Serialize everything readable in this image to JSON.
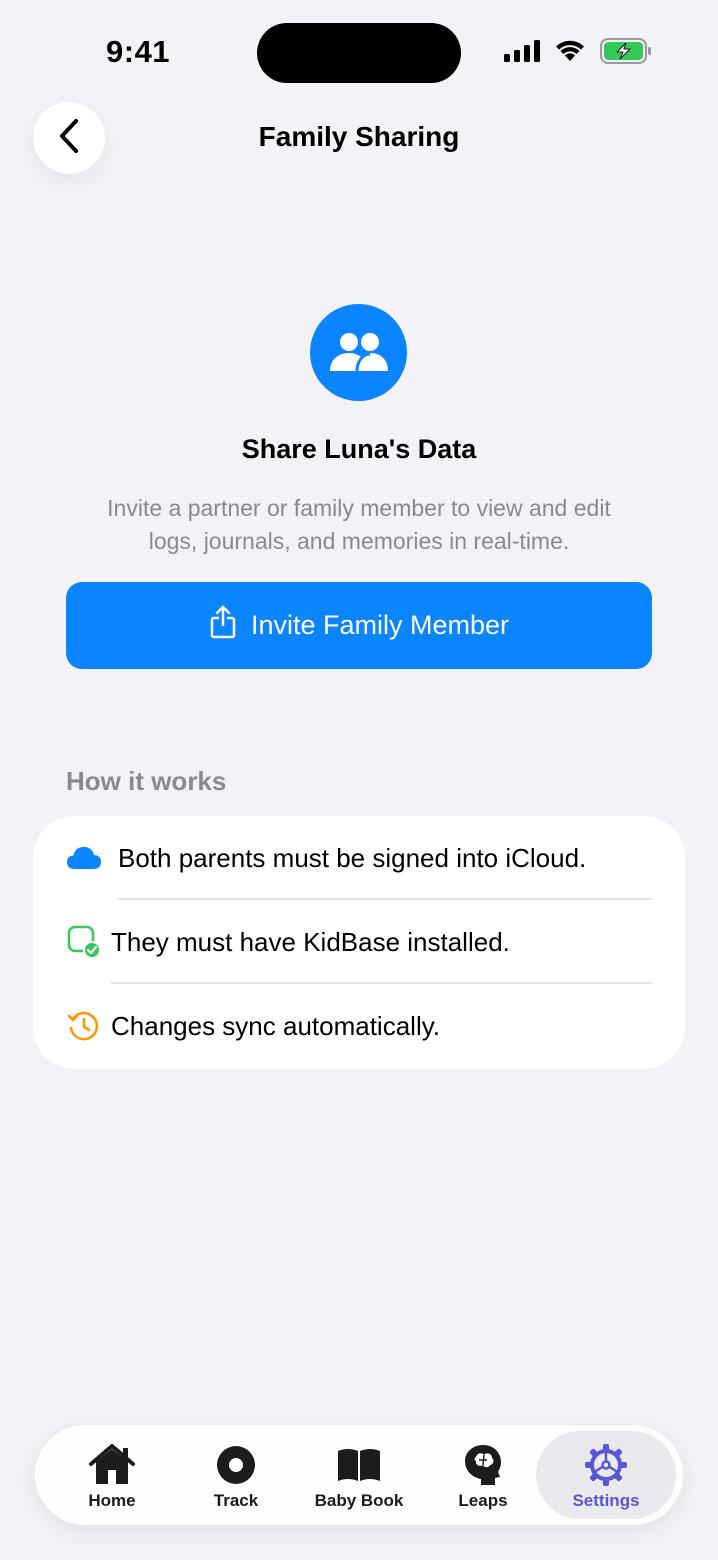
{
  "status_bar": {
    "time": "9:41"
  },
  "nav": {
    "title": "Family Sharing"
  },
  "hero": {
    "title": "Share Luna's Data",
    "description": "Invite a partner or family member to view and edit logs, journals, and memories in real-time."
  },
  "invite_button": {
    "label": "Invite Family Member"
  },
  "how_it_works": {
    "header": "How it works",
    "items": [
      {
        "icon": "cloud-icon",
        "text": "Both parents must be signed into iCloud.",
        "color": "#0A84FF"
      },
      {
        "icon": "app-check-icon",
        "text": "They must have KidBase installed.",
        "color": "#34C759"
      },
      {
        "icon": "history-icon",
        "text": "Changes sync automatically.",
        "color": "#FF9500"
      }
    ]
  },
  "tab_bar": {
    "items": [
      {
        "icon": "home-icon",
        "label": "Home"
      },
      {
        "icon": "track-icon",
        "label": "Track"
      },
      {
        "icon": "book-icon",
        "label": "Baby Book"
      },
      {
        "icon": "brain-icon",
        "label": "Leaps"
      },
      {
        "icon": "gear-icon",
        "label": "Settings",
        "active": true
      }
    ]
  },
  "colors": {
    "accent": "#0A84FF",
    "active_tab": "#5856D6",
    "background": "#F2F2F7"
  }
}
